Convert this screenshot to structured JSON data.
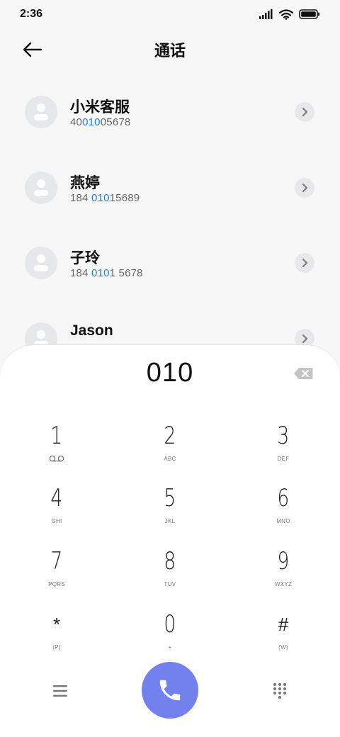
{
  "status_bar": {
    "time": "2:36",
    "icons": [
      "signal-icon",
      "wifi-icon",
      "battery-icon"
    ]
  },
  "header": {
    "title": "通话",
    "back_icon": "arrow-left-icon"
  },
  "contacts": [
    {
      "name": "小米客服",
      "number_parts": [
        {
          "text": "40",
          "hl": false
        },
        {
          "text": "010",
          "hl": true
        },
        {
          "text": "05678",
          "hl": false
        }
      ]
    },
    {
      "name": "燕婷",
      "number_parts": [
        {
          "text": "184 ",
          "hl": false
        },
        {
          "text": "010",
          "hl": true
        },
        {
          "text": "15689",
          "hl": false
        }
      ]
    },
    {
      "name": "子玲",
      "number_parts": [
        {
          "text": "184 ",
          "hl": false
        },
        {
          "text": "010",
          "hl": true
        },
        {
          "text": "1 5678",
          "hl": false
        }
      ]
    },
    {
      "name": "Jason",
      "number_parts": []
    }
  ],
  "dialpad": {
    "input_value": "010",
    "keys": [
      {
        "digit": "1",
        "letters": "",
        "voicemail": true
      },
      {
        "digit": "2",
        "letters": "ABC"
      },
      {
        "digit": "3",
        "letters": "DEF"
      },
      {
        "digit": "4",
        "letters": "GHI"
      },
      {
        "digit": "5",
        "letters": "JKL"
      },
      {
        "digit": "6",
        "letters": "MNO"
      },
      {
        "digit": "7",
        "letters": "PQRS"
      },
      {
        "digit": "8",
        "letters": "TUV"
      },
      {
        "digit": "9",
        "letters": "WXYZ"
      },
      {
        "digit": "*",
        "letters": "(P)"
      },
      {
        "digit": "0",
        "letters": "+"
      },
      {
        "digit": "#",
        "letters": "(W)"
      }
    ]
  },
  "colors": {
    "accent": "#7381ee",
    "highlight": "#1a86e0",
    "background": "#f7f7f7"
  },
  "bottom_icons": {
    "menu": "menu-icon",
    "call": "phone-icon",
    "keypad": "dialpad-icon"
  }
}
